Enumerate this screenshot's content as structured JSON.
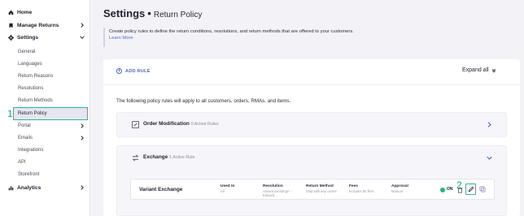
{
  "sidebar": {
    "top_items": [
      {
        "label": "Home",
        "icon": "home-icon"
      },
      {
        "label": "Manage Returns",
        "icon": "return-icon"
      },
      {
        "label": "Settings",
        "icon": "gear-icon"
      },
      {
        "label": "Analytics",
        "icon": "bar-chart-icon"
      }
    ],
    "settings_items": [
      {
        "label": "General"
      },
      {
        "label": "Languages"
      },
      {
        "label": "Return Reasons"
      },
      {
        "label": "Resolutions"
      },
      {
        "label": "Return Methods"
      },
      {
        "label": "Return Policy",
        "selected": true
      },
      {
        "label": "Portal"
      },
      {
        "label": "Emails"
      },
      {
        "label": "Integrations"
      },
      {
        "label": "API"
      },
      {
        "label": "Storefront"
      }
    ],
    "step_marker": "1"
  },
  "header": {
    "title": "Settings",
    "separator": "•",
    "subtitle": "Return Policy"
  },
  "intro": {
    "description": "Create policy rules to define the return conditions, resolutions, and return methods that are offered to your customers.",
    "link": "Learn More"
  },
  "panel": {
    "add_rule_label": "ADD RULE",
    "expand_all_label": "Expand all",
    "applies_text": "The following policy rules will apply to all customers, orders, RMAs, and items."
  },
  "rules": [
    {
      "title": "Order Modification",
      "count": "0 Active Rules",
      "icon": "edit-icon",
      "expanded": false
    },
    {
      "title": "Exchange",
      "count": "1 Active Rule",
      "icon": "swap-icon",
      "expanded": true
    }
  ],
  "variant": {
    "name": "Variant Exchange",
    "columns": [
      {
        "header": "Used In",
        "value": "All"
      },
      {
        "header": "Resolution",
        "value": "Variant exchange - Edward"
      },
      {
        "header": "Return Method",
        "value": "Ship with any carrier"
      },
      {
        "header": "Fees",
        "value": "Includes $0 fees"
      },
      {
        "header": "Approval",
        "value": "Manual"
      }
    ],
    "status": "ON",
    "step_marker": "2"
  },
  "colors": {
    "accent": "#2bb59a",
    "link": "#4a66c9",
    "toggle_on": "#23b870",
    "background": "#f3f3f7"
  }
}
